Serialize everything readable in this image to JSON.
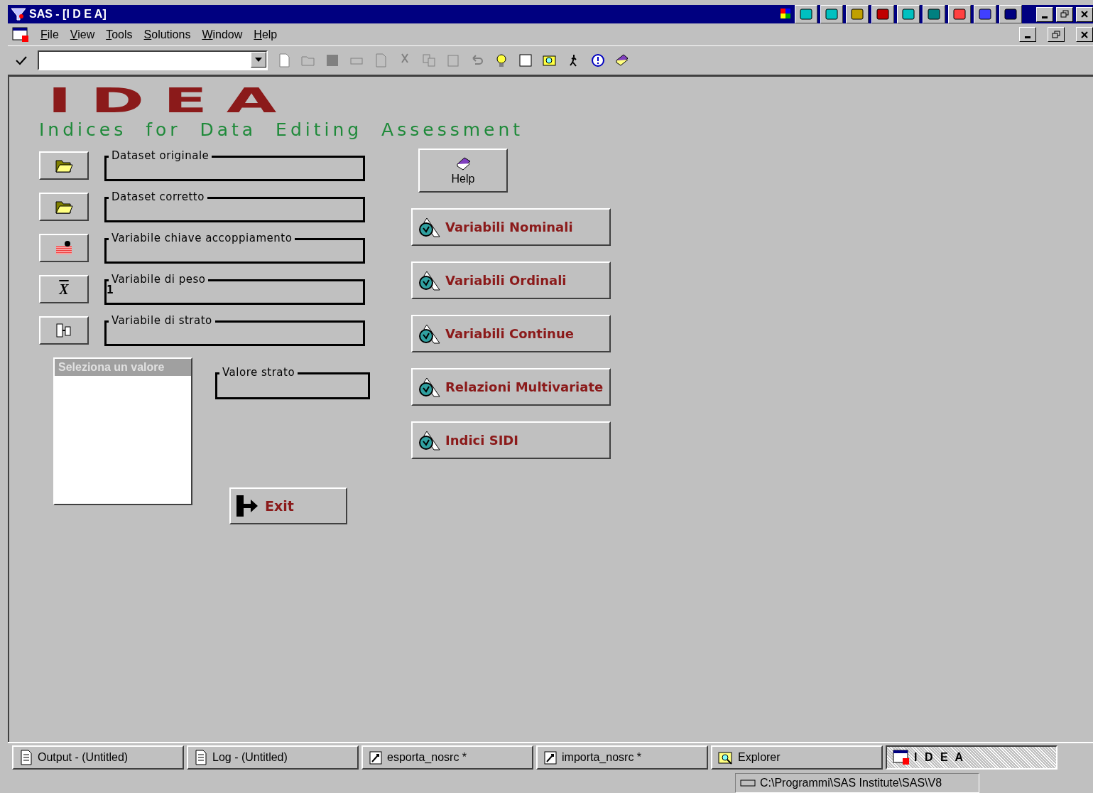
{
  "window": {
    "title": "SAS - [I D E A]"
  },
  "menu": [
    "File",
    "View",
    "Tools",
    "Solutions",
    "Window",
    "Help"
  ],
  "logo": {
    "title": "IDEA",
    "subtitle": "Indices for Data Editing Assessment"
  },
  "fields": [
    {
      "label": "Dataset originale",
      "kind": "folder"
    },
    {
      "label": "Dataset corretto",
      "kind": "folder"
    },
    {
      "label": "Variabile chiave accoppiamento",
      "kind": "bricks"
    },
    {
      "label": "Variabile di peso",
      "kind": "symbol",
      "symbol": "X",
      "value": "1"
    },
    {
      "label": "Variabile di strato",
      "kind": "columns"
    }
  ],
  "value_list": {
    "title": "Seleziona un valore",
    "disabled": true
  },
  "stratum_field": {
    "label": "Valore strato"
  },
  "help_button": "Help",
  "analysis_buttons": [
    "Variabili Nominali",
    "Variabili Ordinali",
    "Variabili Continue",
    "Relazioni Multivariate",
    "Indici SIDI"
  ],
  "exit_button": "Exit",
  "taskbar": [
    {
      "label": "Output - (Untitled)",
      "kind": "output",
      "selected": false
    },
    {
      "label": "Log - (Untitled)",
      "kind": "log",
      "selected": false
    },
    {
      "label": "esporta_nosrc *",
      "kind": "program",
      "selected": false
    },
    {
      "label": "importa_nosrc *",
      "kind": "program",
      "selected": false
    },
    {
      "label": "Explorer",
      "kind": "explorer",
      "selected": false
    },
    {
      "label": "I D E A",
      "kind": "window",
      "selected": true
    }
  ],
  "status_bar": {
    "path": "C:\\Programmi\\SAS Institute\\SAS\\V8"
  }
}
